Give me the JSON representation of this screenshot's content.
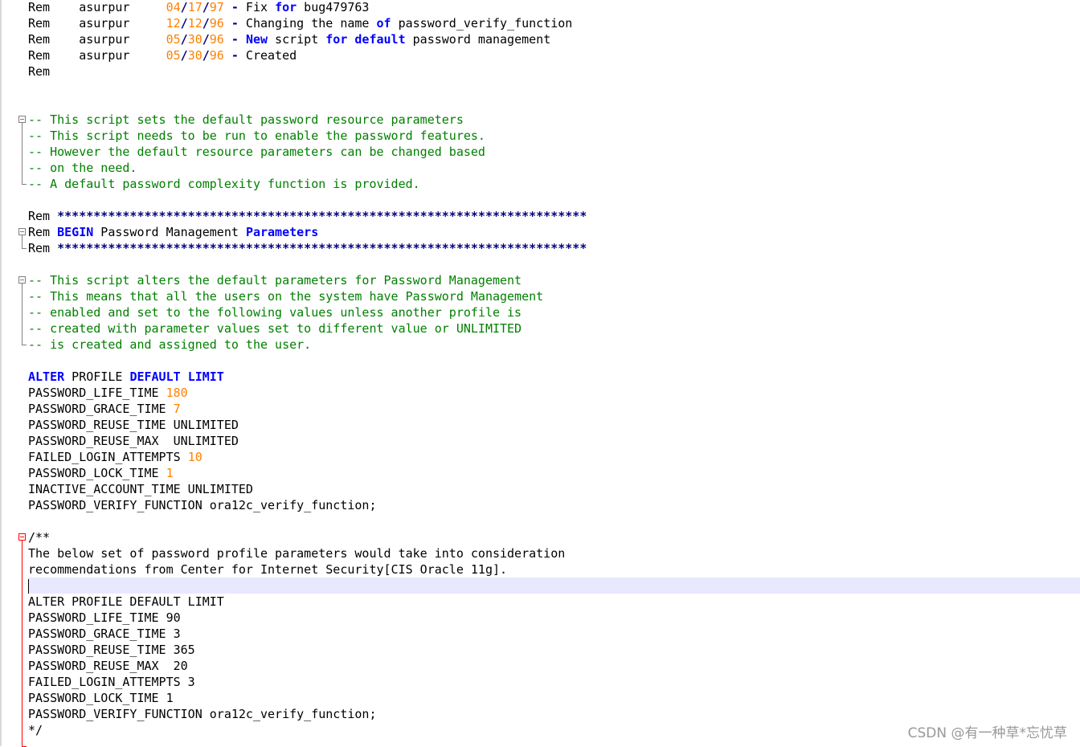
{
  "editor": {
    "lines": [
      {
        "tokens": [
          [
            "t",
            "Rem    asurpur     "
          ],
          [
            "n",
            "04"
          ],
          [
            "o",
            "/"
          ],
          [
            "n",
            "17"
          ],
          [
            "o",
            "/"
          ],
          [
            "n",
            "97"
          ],
          [
            "t",
            " "
          ],
          [
            "o",
            "-"
          ],
          [
            "t",
            " Fix "
          ],
          [
            "k",
            "for"
          ],
          [
            "t",
            " bug479763"
          ]
        ]
      },
      {
        "tokens": [
          [
            "t",
            "Rem    asurpur     "
          ],
          [
            "n",
            "12"
          ],
          [
            "o",
            "/"
          ],
          [
            "n",
            "12"
          ],
          [
            "o",
            "/"
          ],
          [
            "n",
            "96"
          ],
          [
            "t",
            " "
          ],
          [
            "o",
            "-"
          ],
          [
            "t",
            " Changing the name "
          ],
          [
            "k",
            "of"
          ],
          [
            "t",
            " password_verify_function"
          ]
        ]
      },
      {
        "tokens": [
          [
            "t",
            "Rem    asurpur     "
          ],
          [
            "n",
            "05"
          ],
          [
            "o",
            "/"
          ],
          [
            "n",
            "30"
          ],
          [
            "o",
            "/"
          ],
          [
            "n",
            "96"
          ],
          [
            "t",
            " "
          ],
          [
            "o",
            "-"
          ],
          [
            "t",
            " "
          ],
          [
            "k",
            "New"
          ],
          [
            "t",
            " script "
          ],
          [
            "k",
            "for"
          ],
          [
            "t",
            " "
          ],
          [
            "k",
            "default"
          ],
          [
            "t",
            " password management"
          ]
        ]
      },
      {
        "tokens": [
          [
            "t",
            "Rem    asurpur     "
          ],
          [
            "n",
            "05"
          ],
          [
            "o",
            "/"
          ],
          [
            "n",
            "30"
          ],
          [
            "o",
            "/"
          ],
          [
            "n",
            "96"
          ],
          [
            "t",
            " "
          ],
          [
            "o",
            "-"
          ],
          [
            "t",
            " Created"
          ]
        ]
      },
      {
        "tokens": [
          [
            "t",
            "Rem"
          ]
        ]
      },
      {
        "tokens": []
      },
      {
        "tokens": []
      },
      {
        "tokens": [
          [
            "c",
            "-- This script sets the default password resource parameters"
          ]
        ]
      },
      {
        "tokens": [
          [
            "c",
            "-- This script needs to be run to enable the password features."
          ]
        ]
      },
      {
        "tokens": [
          [
            "c",
            "-- However the default resource parameters can be changed based"
          ]
        ]
      },
      {
        "tokens": [
          [
            "c",
            "-- on the need."
          ]
        ]
      },
      {
        "tokens": [
          [
            "c",
            "-- A default password complexity function is provided."
          ]
        ]
      },
      {
        "tokens": []
      },
      {
        "tokens": [
          [
            "t",
            "Rem "
          ],
          [
            "s",
            "*************************************************************************"
          ]
        ]
      },
      {
        "tokens": [
          [
            "t",
            "Rem "
          ],
          [
            "k",
            "BEGIN"
          ],
          [
            "t",
            " Password Management "
          ],
          [
            "k",
            "Parameters"
          ]
        ]
      },
      {
        "tokens": [
          [
            "t",
            "Rem "
          ],
          [
            "s",
            "*************************************************************************"
          ]
        ]
      },
      {
        "tokens": []
      },
      {
        "tokens": [
          [
            "c",
            "-- This script alters the default parameters for Password Management"
          ]
        ]
      },
      {
        "tokens": [
          [
            "c",
            "-- This means that all the users on the system have Password Management"
          ]
        ]
      },
      {
        "tokens": [
          [
            "c",
            "-- enabled and set to the following values unless another profile is"
          ]
        ]
      },
      {
        "tokens": [
          [
            "c",
            "-- created with parameter values set to different value or UNLIMITED"
          ]
        ]
      },
      {
        "tokens": [
          [
            "c",
            "-- is created and assigned to the user."
          ]
        ]
      },
      {
        "tokens": []
      },
      {
        "tokens": [
          [
            "k",
            "ALTER"
          ],
          [
            "t",
            " PROFILE "
          ],
          [
            "k",
            "DEFAULT"
          ],
          [
            "t",
            " "
          ],
          [
            "k",
            "LIMIT"
          ]
        ]
      },
      {
        "tokens": [
          [
            "t",
            "PASSWORD_LIFE_TIME "
          ],
          [
            "n",
            "180"
          ]
        ]
      },
      {
        "tokens": [
          [
            "t",
            "PASSWORD_GRACE_TIME "
          ],
          [
            "n",
            "7"
          ]
        ]
      },
      {
        "tokens": [
          [
            "t",
            "PASSWORD_REUSE_TIME UNLIMITED"
          ]
        ]
      },
      {
        "tokens": [
          [
            "t",
            "PASSWORD_REUSE_MAX  UNLIMITED"
          ]
        ]
      },
      {
        "tokens": [
          [
            "t",
            "FAILED_LOGIN_ATTEMPTS "
          ],
          [
            "n",
            "10"
          ]
        ]
      },
      {
        "tokens": [
          [
            "t",
            "PASSWORD_LOCK_TIME "
          ],
          [
            "n",
            "1"
          ]
        ]
      },
      {
        "tokens": [
          [
            "t",
            "INACTIVE_ACCOUNT_TIME UNLIMITED"
          ]
        ]
      },
      {
        "tokens": [
          [
            "t",
            "PASSWORD_VERIFY_FUNCTION ora12c_verify_function;"
          ]
        ]
      },
      {
        "tokens": []
      },
      {
        "tokens": [
          [
            "t",
            "/**"
          ]
        ]
      },
      {
        "tokens": [
          [
            "t",
            "The below set of password profile parameters would take into consideration"
          ]
        ]
      },
      {
        "tokens": [
          [
            "t",
            "recommendations from Center for Internet Security[CIS Oracle 11g]."
          ]
        ]
      },
      {
        "tokens": [],
        "current": true
      },
      {
        "tokens": [
          [
            "t",
            "ALTER PROFILE DEFAULT LIMIT"
          ]
        ]
      },
      {
        "tokens": [
          [
            "t",
            "PASSWORD_LIFE_TIME 90"
          ]
        ]
      },
      {
        "tokens": [
          [
            "t",
            "PASSWORD_GRACE_TIME 3"
          ]
        ]
      },
      {
        "tokens": [
          [
            "t",
            "PASSWORD_REUSE_TIME 365"
          ]
        ]
      },
      {
        "tokens": [
          [
            "t",
            "PASSWORD_REUSE_MAX  20"
          ]
        ]
      },
      {
        "tokens": [
          [
            "t",
            "FAILED_LOGIN_ATTEMPTS 3"
          ]
        ]
      },
      {
        "tokens": [
          [
            "t",
            "PASSWORD_LOCK_TIME 1"
          ]
        ]
      },
      {
        "tokens": [
          [
            "t",
            "PASSWORD_VERIFY_FUNCTION ora12c_verify_function;"
          ]
        ]
      },
      {
        "tokens": [
          [
            "t",
            "*/"
          ]
        ]
      }
    ],
    "folds": [
      {
        "start": 7,
        "end": 11,
        "color": "#808080"
      },
      {
        "start": 14,
        "end": 15,
        "color": "#808080"
      },
      {
        "start": 17,
        "end": 21,
        "color": "#808080"
      },
      {
        "start": 33,
        "end": 46,
        "color": "#ff0000"
      }
    ]
  },
  "watermark": {
    "text": "CSDN @有一种草*忘忧草"
  },
  "colors": {
    "keyword": "#0000ff",
    "number": "#ff8000",
    "comment": "#008000",
    "operator": "#000080",
    "current_line": "#e8e8ff"
  }
}
